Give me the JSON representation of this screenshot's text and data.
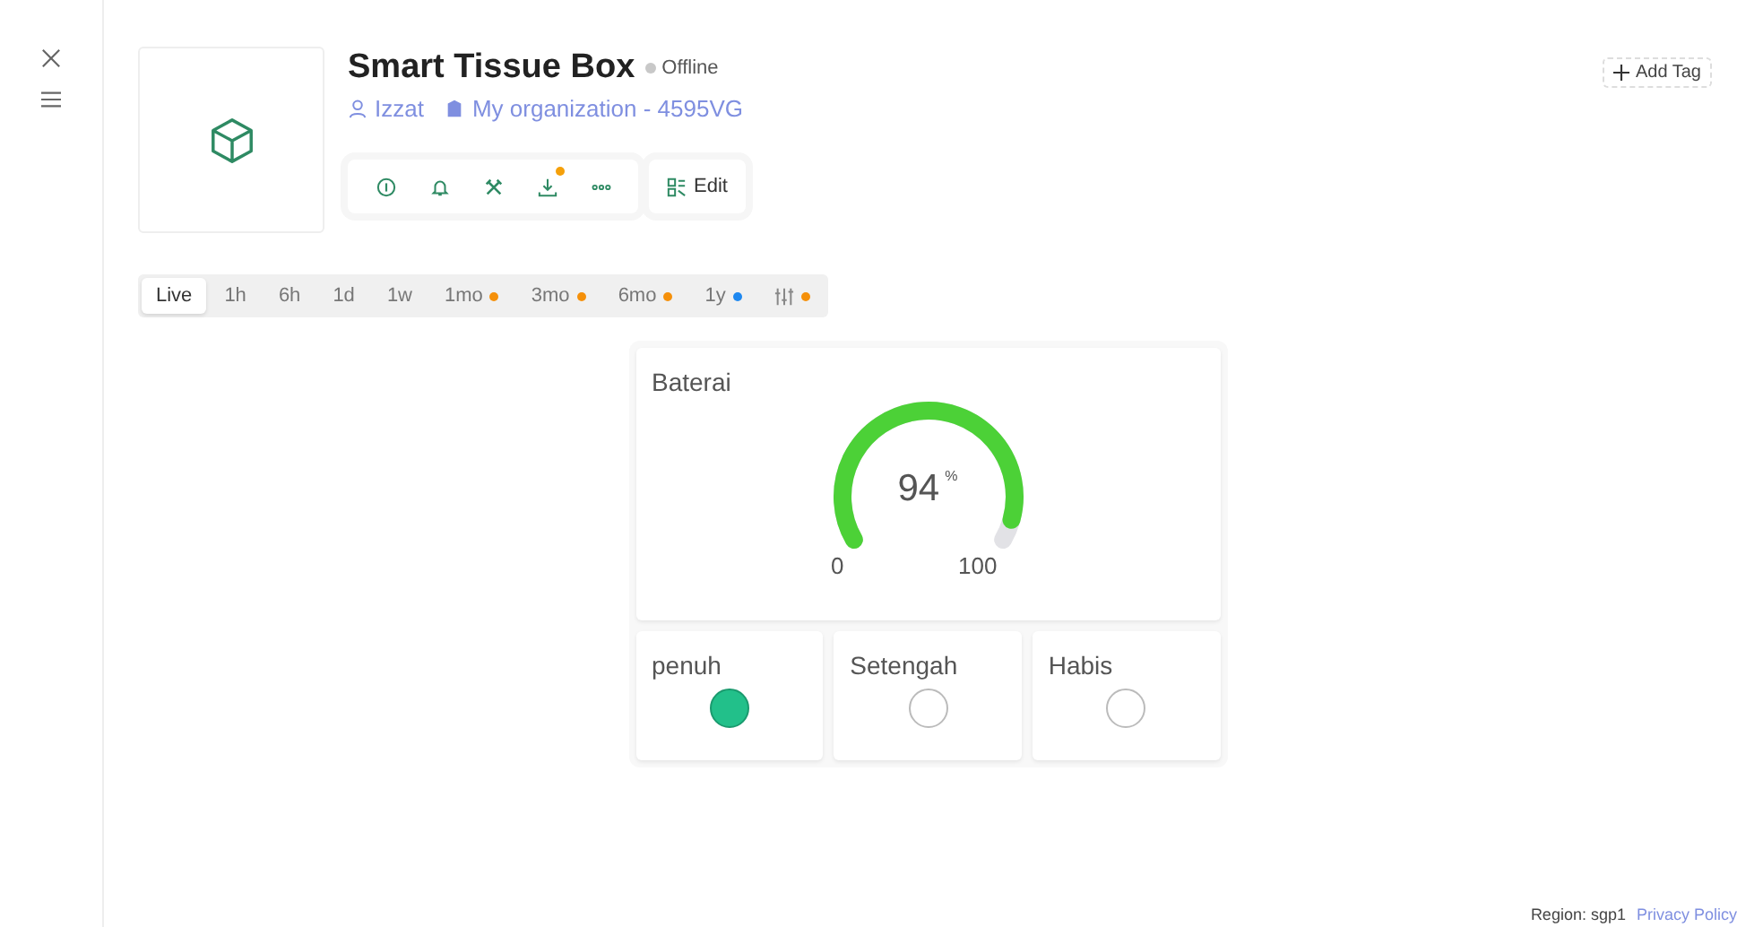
{
  "device": {
    "name": "Smart Tissue Box",
    "status": "Offline",
    "online": false,
    "owner": "Izzat",
    "organization": "My organization - 4595VG"
  },
  "actions": [
    {
      "kind": "info",
      "badge": false
    },
    {
      "kind": "bell",
      "badge": false
    },
    {
      "kind": "tools",
      "badge": false
    },
    {
      "kind": "download",
      "badge": true
    },
    {
      "kind": "more",
      "badge": false
    }
  ],
  "edit_button": "Edit",
  "add_tag": "Add Tag",
  "ranges": [
    {
      "label": "Live",
      "selected": true
    },
    {
      "label": "1h",
      "selected": false
    },
    {
      "label": "6h",
      "selected": false
    },
    {
      "label": "1d",
      "selected": false
    },
    {
      "label": "1w",
      "selected": false
    },
    {
      "label": "1mo",
      "selected": false,
      "color": "#f5900a"
    },
    {
      "label": "3mo",
      "selected": false,
      "color": "#f5900a"
    },
    {
      "label": "6mo",
      "selected": false,
      "color": "#f5900a"
    },
    {
      "label": "1y",
      "selected": false,
      "color": "#1e88f0"
    },
    {
      "kind": "filter",
      "selected": false,
      "color": "#f5900a"
    }
  ],
  "gauge": {
    "title": "Baterai",
    "value": "94",
    "unit": "%",
    "min": "0",
    "max": "100"
  },
  "leds": [
    {
      "label": "penuh",
      "on": true
    },
    {
      "label": "Setengah",
      "on": false
    },
    {
      "label": "Habis",
      "on": false
    }
  ],
  "footer": {
    "region": "Region: sgp1",
    "privacy": "Privacy Policy"
  }
}
